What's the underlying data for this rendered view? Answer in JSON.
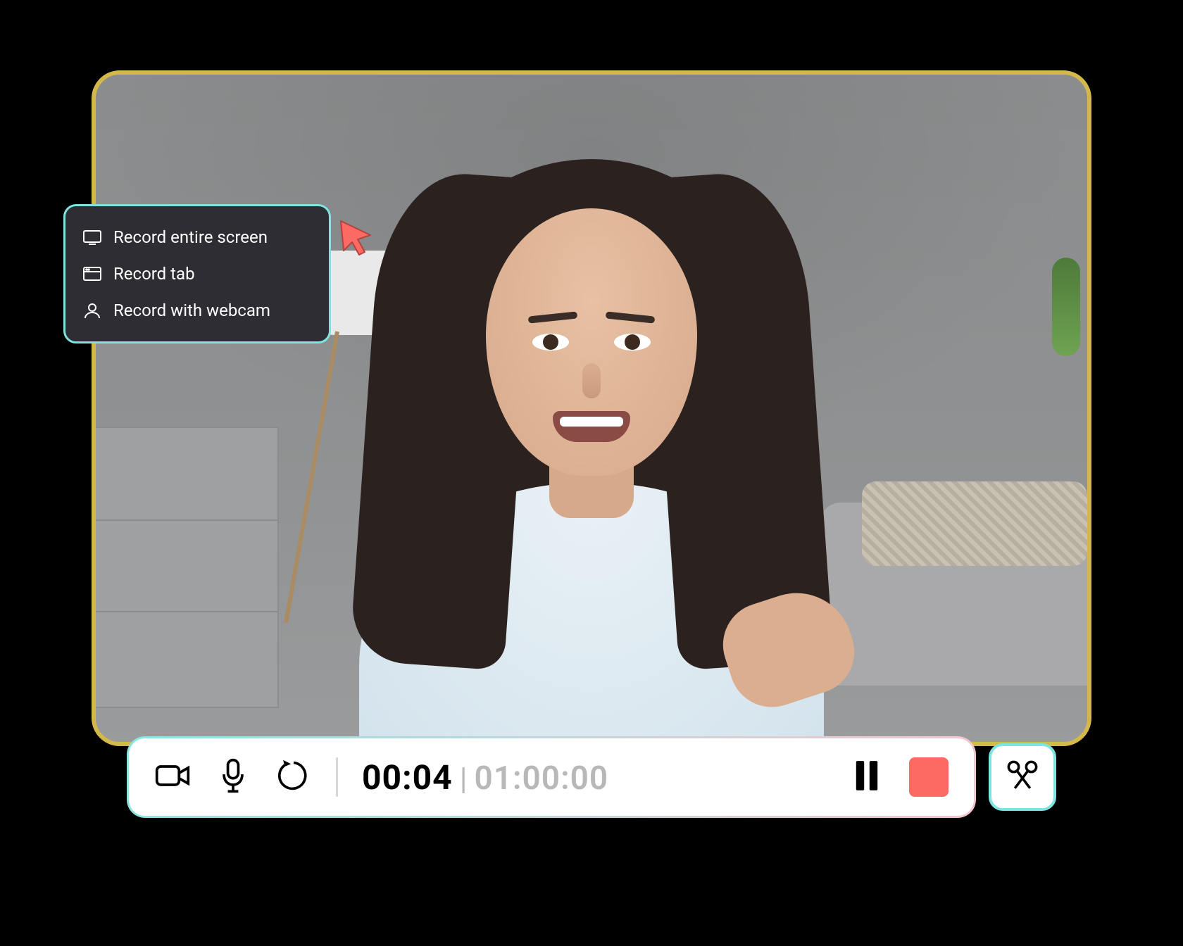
{
  "menu": {
    "items": [
      {
        "icon": "monitor-icon",
        "label": "Record entire screen"
      },
      {
        "icon": "window-icon",
        "label": "Record tab"
      },
      {
        "icon": "person-icon",
        "label": "Record with webcam"
      }
    ]
  },
  "toolbar": {
    "elapsed": "00:04",
    "separator": "|",
    "total": "01:00:00"
  },
  "colors": {
    "frame_border": "#d4b94a",
    "accent_teal": "#7fe4df",
    "stop_red": "#fc6a63",
    "menu_bg": "#2d2d33"
  },
  "icons": {
    "camera": "camera-icon",
    "mic": "microphone-icon",
    "restart": "restart-icon",
    "pause": "pause-icon",
    "stop": "stop-icon",
    "trim": "scissors-icon",
    "cursor": "cursor-pointer-icon"
  }
}
